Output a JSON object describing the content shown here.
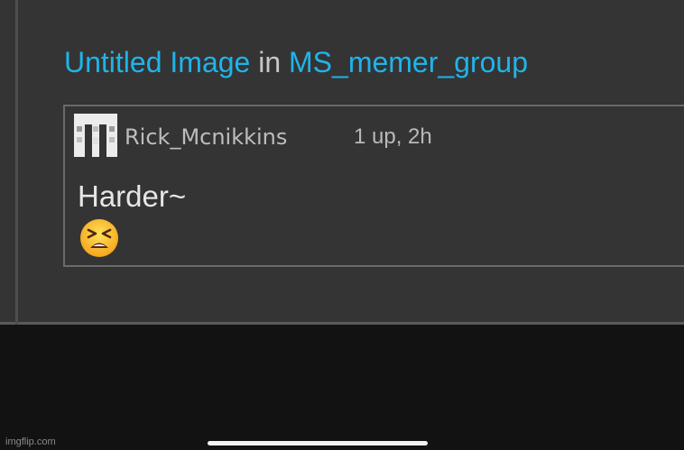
{
  "post": {
    "image_link_label": "Untitled Image",
    "connector": "in",
    "group_link_label": "MS_memer_group"
  },
  "comment": {
    "avatar_icon": "avatar-icon",
    "username": "Rick_Mcnikkins",
    "meta": "1 up, 2h",
    "text": "Harder~",
    "emoji_icon": "tired-face-emoji"
  },
  "footer": {
    "watermark": "imgflip.com"
  },
  "colors": {
    "link": "#1fb4ea",
    "panel_bg": "#343434",
    "page_bg": "#121212"
  }
}
